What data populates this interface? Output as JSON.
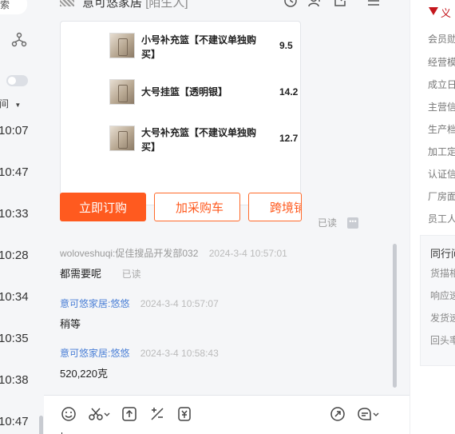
{
  "left_list": {
    "search_text": "索",
    "filter_label": "间",
    "times": [
      "10:07",
      "10:47",
      "10:33",
      "10:28",
      "10:34",
      "10:35",
      "10:38",
      "10:47"
    ]
  },
  "chat": {
    "title": "意可悠家居",
    "title_tag": "[陌生人]",
    "card": {
      "products": [
        {
          "name": "小号补充篮【不建议单独购买】",
          "price": "9.5"
        },
        {
          "name": "大号挂篮【透明银】",
          "price": "14.2"
        },
        {
          "name": "大号补充篮【不建议单独购买】",
          "price": "12.7"
        }
      ],
      "buttons": {
        "order": "立即订购",
        "cart": "加采购车",
        "cross_border": "跨境铺"
      },
      "read_status": "已读"
    },
    "messages": [
      {
        "sender": "woloveshuqi:促佳搜品开发部032",
        "time": "2024-3-4 10:57:01",
        "text": "都需要呢",
        "read": "已读",
        "self": false
      },
      {
        "sender": "意可悠家居:悠悠",
        "time": "2024-3-4 10:57:07",
        "text": "稍等",
        "read": "",
        "self": true
      },
      {
        "sender": "意可悠家居:悠悠",
        "time": "2024-3-4 10:58:43",
        "text": "520,220克",
        "read": "",
        "self": true
      }
    ]
  },
  "right_panel": {
    "brand": "义",
    "items": [
      "会员勋",
      "经营模",
      "成立日",
      "主营信",
      "生产档",
      "加工定",
      "认证信",
      "厂房面",
      "员工人"
    ],
    "same_section": {
      "title": "同行间",
      "items": [
        "货描相",
        "响应速",
        "发货速",
        "回头率"
      ]
    }
  },
  "colors": {
    "accent": "#ff5a1f",
    "link_blue": "#4a7fd6",
    "brand_red": "#c4161c"
  }
}
